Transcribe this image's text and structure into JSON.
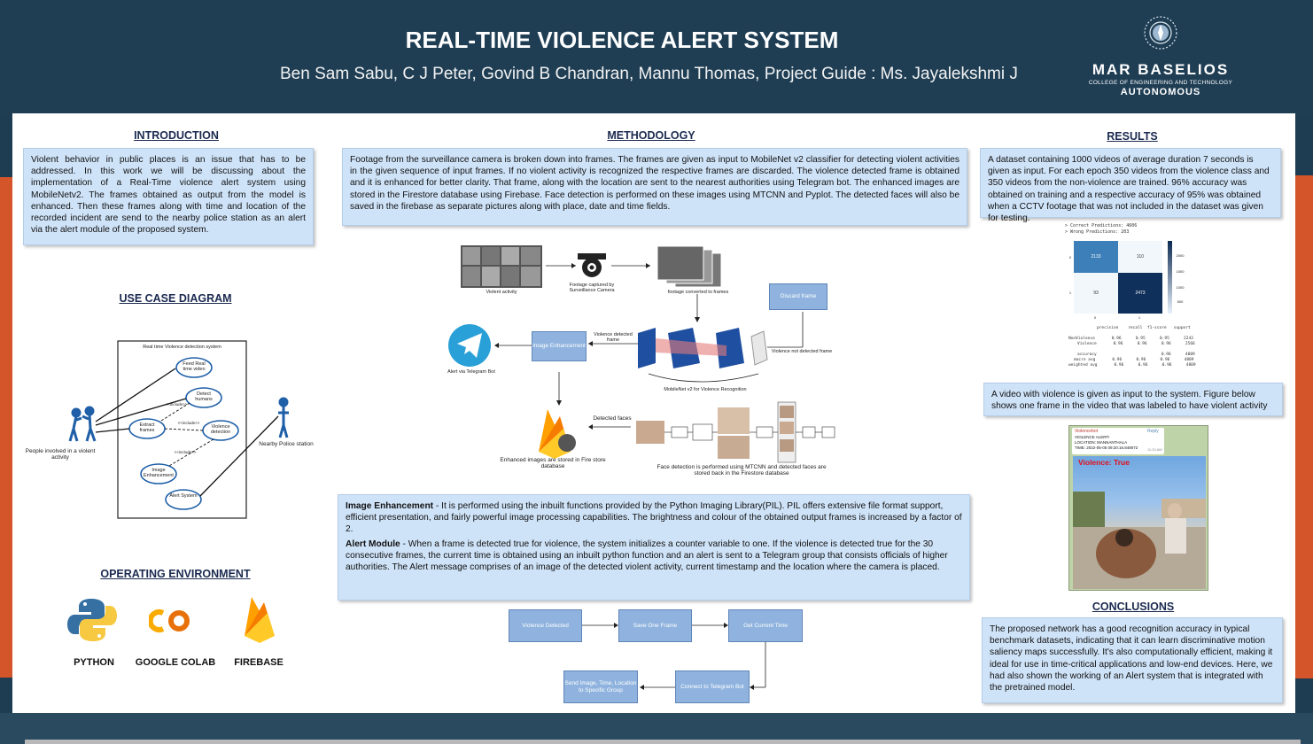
{
  "header": {
    "title": "REAL-TIME VIOLENCE ALERT SYSTEM",
    "authors": "Ben Sam Sabu, C J Peter, Govind B Chandran, Mannu Thomas, Project Guide : Ms. Jayalekshmi J",
    "logo": {
      "name": "MAR BASELIOS",
      "sub": "COLLEGE OF ENGINEERING AND TECHNOLOGY",
      "tag": "AUTONOMOUS"
    }
  },
  "introduction": {
    "heading": "INTRODUCTION",
    "text": "Violent behavior in public places is an issue that has to be addressed. In this work we will be discussing about the implementation of a Real-Time violence alert system using MobileNetv2. The frames obtained as output from the model is enhanced. Then these frames along with time and location of the recorded incident are send to the nearby police station as an alert via the alert module of the proposed system."
  },
  "use_case": {
    "heading": "USE CASE DIAGRAM",
    "system_title": "Real time Violence detection system",
    "actor_left": "People involved in a violent activity",
    "actor_right": "Nearby Police station",
    "cases": [
      "Feed Real time video",
      "Detect humans",
      "Extract frames",
      "Violence detection",
      "Image Enhancement",
      "Alert System"
    ],
    "rel1": "<<include>>",
    "rel2": "<<include>>",
    "rel3": "<<include>>"
  },
  "environment": {
    "heading": "OPERATING ENVIRONMENT",
    "items": [
      "PYTHON",
      "GOOGLE COLAB",
      "FIREBASE"
    ]
  },
  "methodology": {
    "heading": "METHODOLOGY",
    "text": "Footage from the surveillance camera is broken down into frames. The frames are given as input to MobileNet v2 classifier for detecting violent activities in the given sequence of input frames. If no violent activity is recognized the respective frames are discarded. The violence detected frame is obtained and it is enhanced for better clarity. That frame, along with the location are sent to the nearest authorities using Telegram bot. The enhanced images are stored in the Firestore database using Firebase. Face detection is performed on these images using MTCNN and Pyplot. The detected faces will also be saved in the firebase as separate pictures along with place, date and time fields.",
    "diagram": {
      "violent_activity": "Violent activity",
      "camera": "Footage captured by Surveillance Camera",
      "frames": "footage converted to frames",
      "discard": "Discard frame",
      "violence_detected": "Violence detected frame",
      "image_enhancement": "Image Enhancement",
      "not_detected": "Violence not detected frame",
      "mobilenet": "MobileNet v2 for Violence Recognition",
      "telegram": "Alert via Telegram Bot",
      "firebase": "Enhanced images are stored in Fire store database",
      "detected_faces": "Detected faces",
      "face_detection": "Face detection is performed using MTCNN and detected faces are stored back in the Firestore database"
    },
    "enhancement_title": "Image Enhancement",
    "enhancement_text": " - It is performed using the inbuilt functions provided by the Python Imaging Library(PIL). PIL offers extensive file format support, efficient presentation, and fairly powerful image processing capabilities. The brightness and colour of the obtained output frames is increased by a factor of 2.",
    "alert_title": "Alert Module",
    "alert_text": " - When a frame is detected true for violence, the system initializes a counter variable to one. If the violence is detected true for the 30 consecutive frames, the current time is obtained using an inbuilt python function and an alert is sent to a Telegram group that consists officials of higher authorities. The Alert message comprises of an image of the detected violent activity, current timestamp and the location where the camera is placed.",
    "flow": [
      "Violence Detected",
      "Save One Frame",
      "Get Current Time",
      "Connect to Telegram Bot",
      "Send Image, Time, Location to Specific Group"
    ]
  },
  "results": {
    "heading": "RESULTS",
    "text": "A dataset containing 1000 videos of average duration 7 seconds is given as input. For each epoch 350 videos from the violence class and 350 videos from the non-violence are trained. 96% accuracy was obtained on training and a respective accuracy of 95% was obtained when a CCTV footage that was not included in the dataset was given for testing.",
    "matrix": {
      "correct": "> Correct Predictions: 4606",
      "wrong": "> Wrong Predictions: 203",
      "cells": [
        "2133",
        "110",
        "93",
        "2473"
      ],
      "scale": [
        "2000",
        "1500",
        "1000",
        "500"
      ],
      "xticks": [
        "0",
        "1"
      ],
      "yticks": [
        "0",
        "1"
      ],
      "report_header": "precision    recall  f1-score   support",
      "report_rows": [
        "NonViolence       0.96      0.95      0.95      2243",
        "Violence       0.96      0.96      0.96      2566",
        "accuracy                           0.96      4809",
        "macro avg       0.96      0.96      0.96      4809",
        "weighted avg       0.96      0.96      0.96      4809"
      ]
    },
    "video_text": "A video with violence is given as input to the system. Figure below shows one frame in the video that was labeled to have violent activity",
    "telegram_msg": {
      "bot": "Violencebot",
      "reply": "Reply",
      "line1": "VIOLENCE ALERT!",
      "line2": "LOCATION: MANNANTHALA",
      "line3": "TIME: 2022-05-05 09:20:16.848072",
      "time": "11:20 AM",
      "overlay": "Violence:  True"
    }
  },
  "conclusions": {
    "heading": "CONCLUSIONS",
    "text": "The proposed network has a good recognition accuracy in typical benchmark datasets, indicating that it can learn discriminative motion saliency maps successfully. It's also computationally efficient, making it ideal for use in time-critical applications and low-end devices. Here, we had also shown the working of an Alert system that is integrated with the pretrained model."
  },
  "colors": {
    "header": "#1f3e54",
    "accent": "#d4552a",
    "box": "#cfe3f8",
    "flow": "#8fb3de"
  }
}
